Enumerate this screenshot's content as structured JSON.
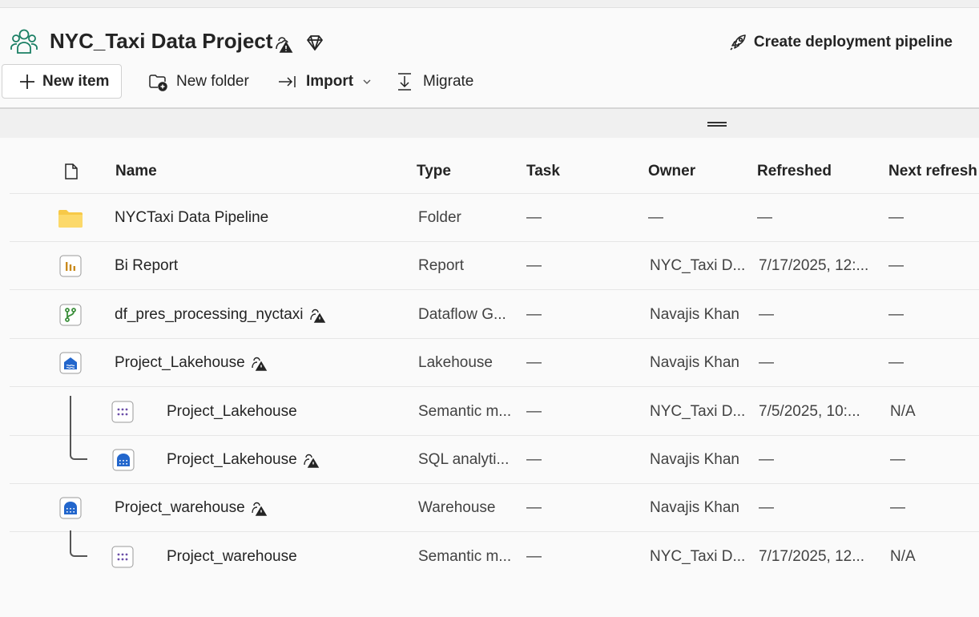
{
  "workspace": {
    "title": "NYC_Taxi Data Project",
    "deploy_label": "Create deployment pipeline"
  },
  "toolbar": {
    "new_item": "New item",
    "new_folder": "New folder",
    "import": "Import",
    "migrate": "Migrate"
  },
  "table": {
    "headers": {
      "name": "Name",
      "type": "Type",
      "task": "Task",
      "owner": "Owner",
      "refreshed": "Refreshed",
      "next_refresh": "Next refresh"
    },
    "rows": [
      {
        "name": "NYCTaxi Data Pipeline",
        "type": "Folder",
        "task": "—",
        "owner": "—",
        "refreshed": "—",
        "next": "—",
        "icon": "folder-icon",
        "flag": false
      },
      {
        "name": "Bi Report",
        "type": "Report",
        "task": "—",
        "owner": "NYC_Taxi D...",
        "refreshed": "7/17/2025, 12:...",
        "next": "—",
        "icon": "report-icon",
        "flag": false
      },
      {
        "name": "df_pres_processing_nyctaxi",
        "type": "Dataflow G...",
        "task": "—",
        "owner": "Navajis Khan",
        "refreshed": "—",
        "next": "—",
        "icon": "dataflow-icon",
        "flag": true
      },
      {
        "name": "Project_Lakehouse",
        "type": "Lakehouse",
        "task": "—",
        "owner": "Navajis Khan",
        "refreshed": "—",
        "next": "—",
        "icon": "lakehouse-icon",
        "flag": true
      },
      {
        "name": "Project_Lakehouse",
        "type": "Semantic m...",
        "task": "—",
        "owner": "NYC_Taxi D...",
        "refreshed": "7/5/2025, 10:...",
        "next": "N/A",
        "icon": "semantic-model-icon",
        "flag": false
      },
      {
        "name": "Project_Lakehouse",
        "type": "SQL analyti...",
        "task": "—",
        "owner": "Navajis Khan",
        "refreshed": "—",
        "next": "—",
        "icon": "sql-endpoint-icon",
        "flag": true
      },
      {
        "name": "Project_warehouse",
        "type": "Warehouse",
        "task": "—",
        "owner": "Navajis Khan",
        "refreshed": "—",
        "next": "—",
        "icon": "warehouse-icon",
        "flag": true
      },
      {
        "name": "Project_warehouse",
        "type": "Semantic m...",
        "task": "—",
        "owner": "NYC_Taxi D...",
        "refreshed": "7/17/2025, 12...",
        "next": "N/A",
        "icon": "semantic-model-icon",
        "flag": false
      }
    ]
  },
  "colors": {
    "accent_green": "#1a7f64",
    "folder_yellow": "#f7c948",
    "report_orange": "#c98a1d",
    "dataflow_green": "#3b8f3b",
    "lakehouse_blue": "#2266cc",
    "semantic_purple": "#6b4ea8"
  }
}
